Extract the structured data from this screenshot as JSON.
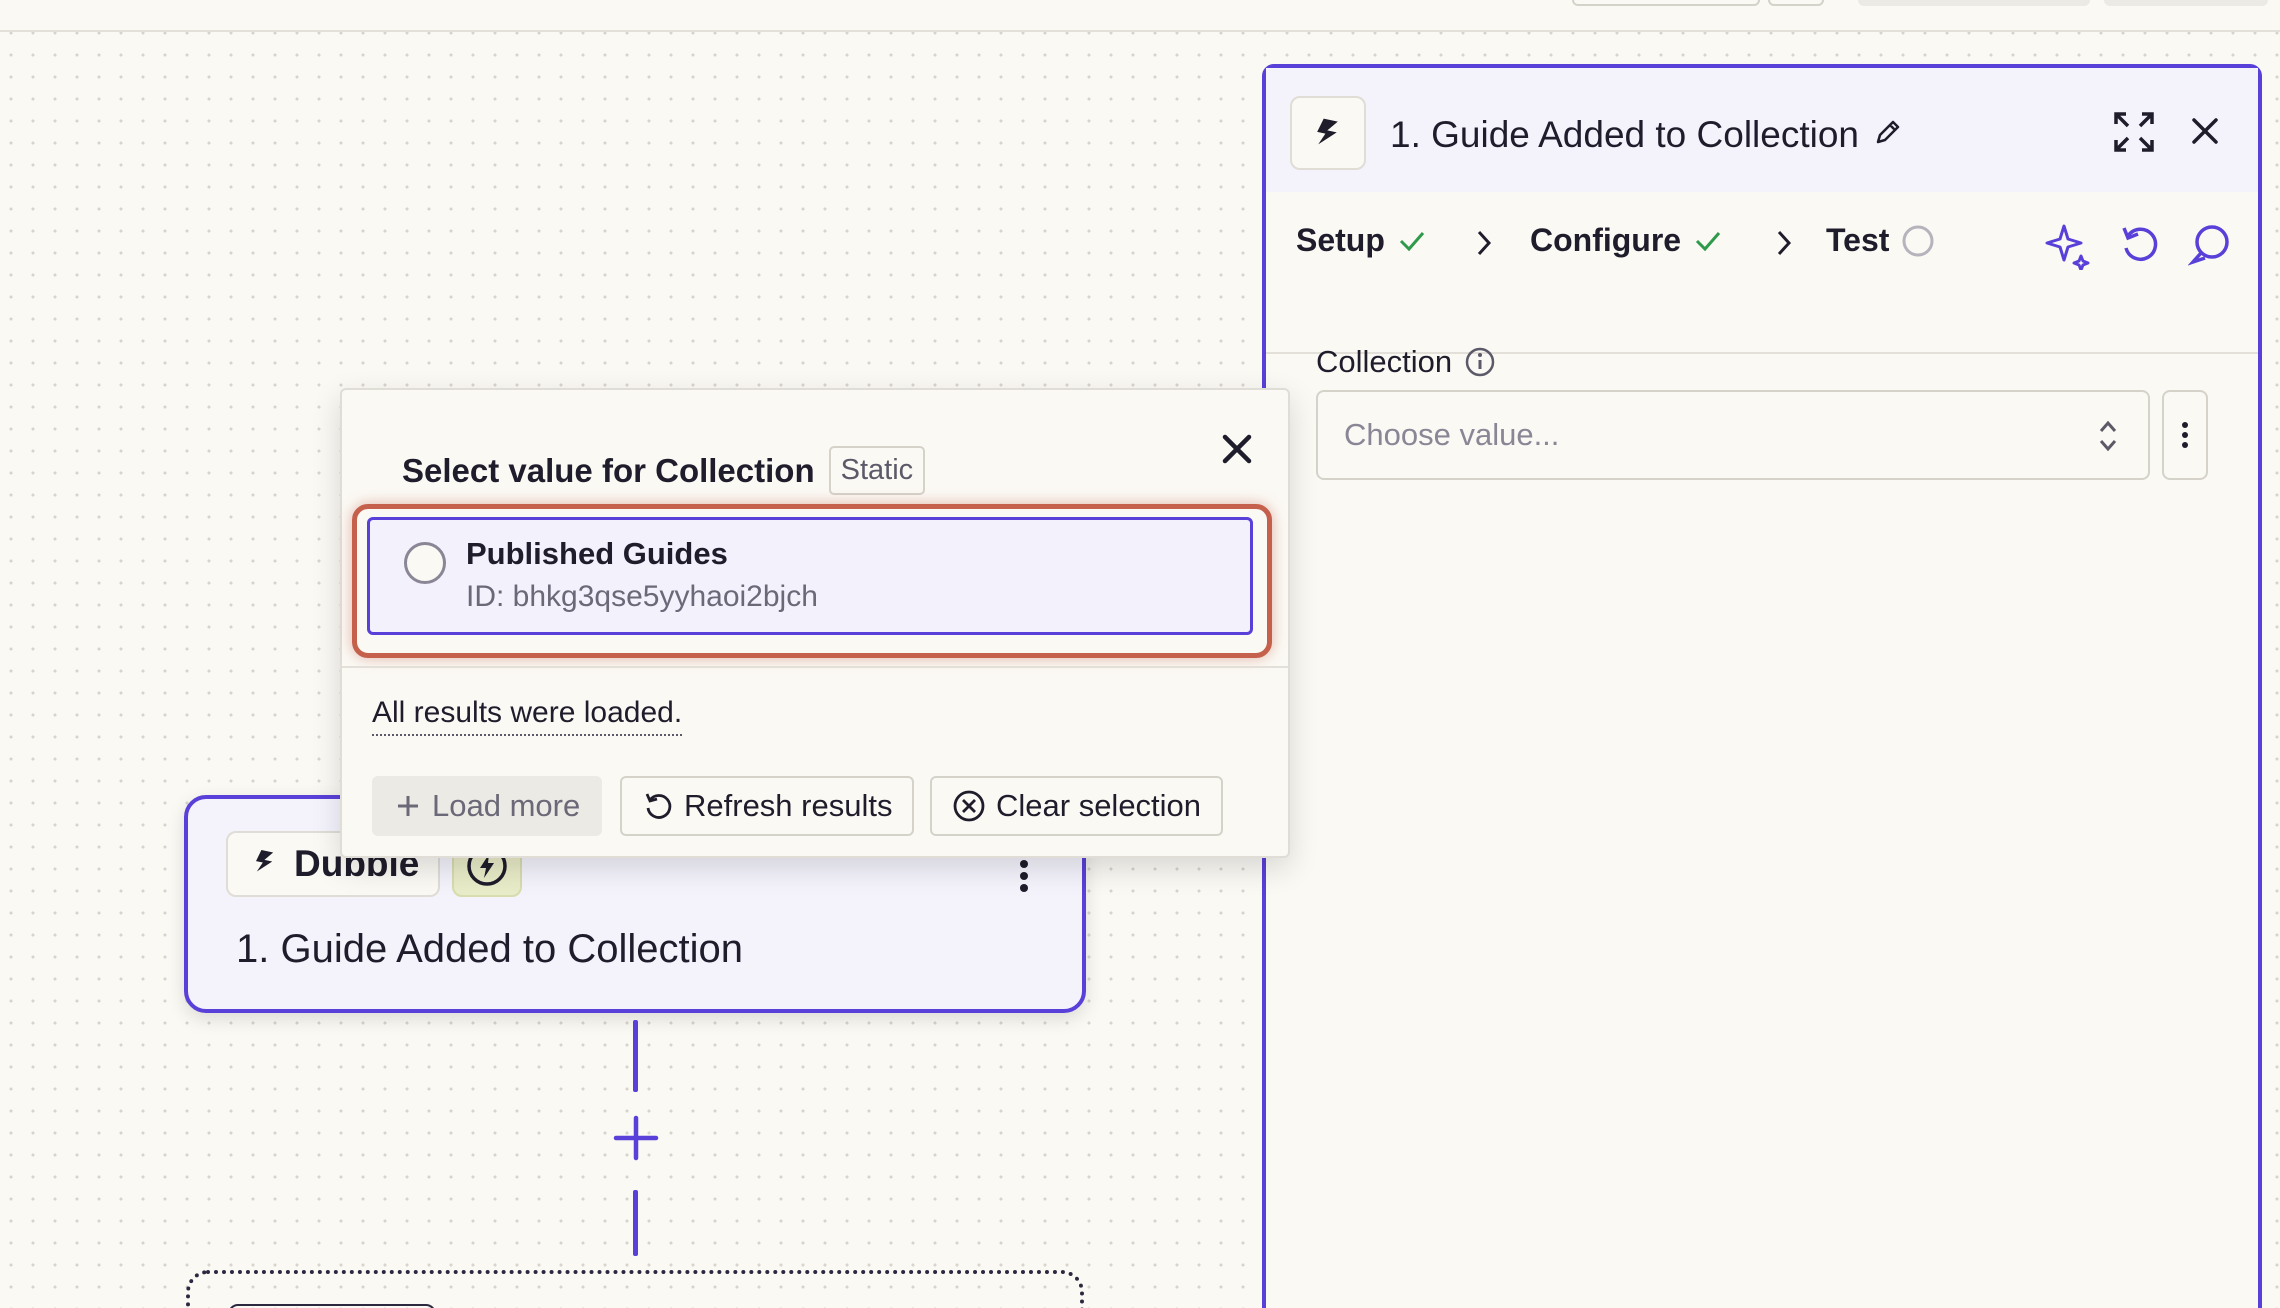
{
  "canvas": {
    "step_card": {
      "app_name": "Dubble",
      "app_icon": "dubble-logo-icon",
      "trigger_icon": "lightning-bolt-icon",
      "title": "1. Guide Added to Collection"
    },
    "add_step_icon": "plus-icon"
  },
  "panel": {
    "title": "1. Guide Added to Collection",
    "app_icon": "dubble-logo-icon",
    "tabs": [
      {
        "label": "Setup",
        "status": "complete"
      },
      {
        "label": "Configure",
        "status": "complete",
        "active": true
      },
      {
        "label": "Test",
        "status": "pending"
      }
    ],
    "field": {
      "label": "Collection",
      "placeholder": "Choose value..."
    }
  },
  "popover": {
    "title": "Select value for Collection",
    "badge": "Static",
    "options": [
      {
        "name": "Published Guides",
        "id_text": "ID: bhkg3qse5yyhaoi2bjch"
      }
    ],
    "status_text": "All results were loaded.",
    "buttons": {
      "load_more": "Load more",
      "refresh": "Refresh results",
      "clear": "Clear selection"
    }
  },
  "colors": {
    "accent": "#5940d8",
    "highlight": "#c4604b",
    "success": "#2e9a4a",
    "background": "#fbf9f4"
  }
}
